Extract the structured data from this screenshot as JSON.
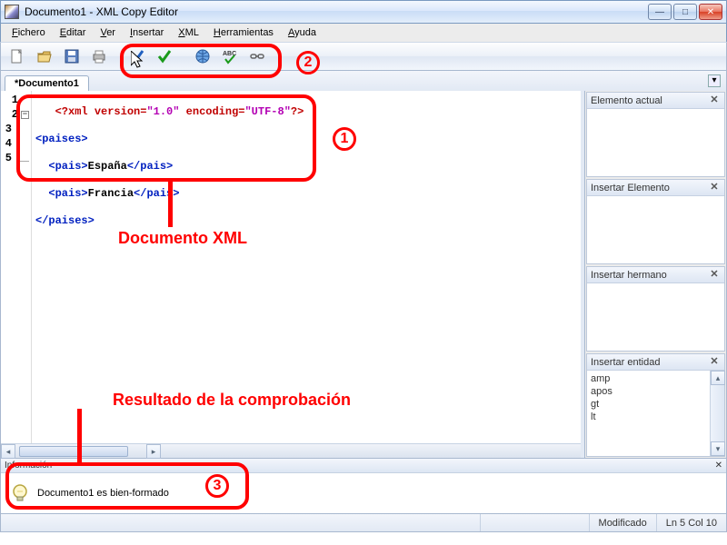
{
  "window": {
    "title": "Documento1 - XML Copy Editor",
    "buttons": {
      "min": "—",
      "max": "□",
      "close": "✕"
    }
  },
  "menu": {
    "fichero": "Fichero",
    "editar": "Editar",
    "ver": "Ver",
    "insertar": "Insertar",
    "xml": "XML",
    "herramientas": "Herramientas",
    "ayuda": "Ayuda"
  },
  "tabs": {
    "doc1": "*Documento1",
    "menu_glyph": "▾"
  },
  "code": {
    "ln1": "1",
    "ln2": "2",
    "ln3": "3",
    "ln4": "4",
    "ln5": "5",
    "r1_a": "<?",
    "r1_b": "xml ",
    "r1_c": "version",
    "r1_d": "=",
    "r1_e": "\"1.0\"",
    "r1_f": " ",
    "r1_g": "encoding",
    "r1_h": "=",
    "r1_i": "\"UTF-8\"",
    "r1_j": "?>",
    "r2_a": "<paises>",
    "r3_a": "<pais>",
    "r3_b": "España",
    "r3_c": "</pais>",
    "r4_a": "<pais>",
    "r4_b": "Francia",
    "r4_c": "</pais>",
    "r5_a": "</paises>"
  },
  "panels": {
    "current": {
      "title": "Elemento actual",
      "close": "✕"
    },
    "insert_el": {
      "title": "Insertar Elemento",
      "close": "✕"
    },
    "insert_sib": {
      "title": "Insertar hermano",
      "close": "✕"
    },
    "insert_ent": {
      "title": "Insertar entidad",
      "close": "✕",
      "items": [
        "amp",
        "apos",
        "gt",
        "lt"
      ]
    }
  },
  "info": {
    "title": "Información",
    "close": "✕",
    "message": "Documento1 es bien-formado"
  },
  "status": {
    "modified": "Modificado",
    "pos": "Ln 5 Col 10"
  },
  "annotations": {
    "n1": "1",
    "n2": "2",
    "n3": "3",
    "doc_label": "Documento XML",
    "result_label": "Resultado de la comprobación"
  }
}
